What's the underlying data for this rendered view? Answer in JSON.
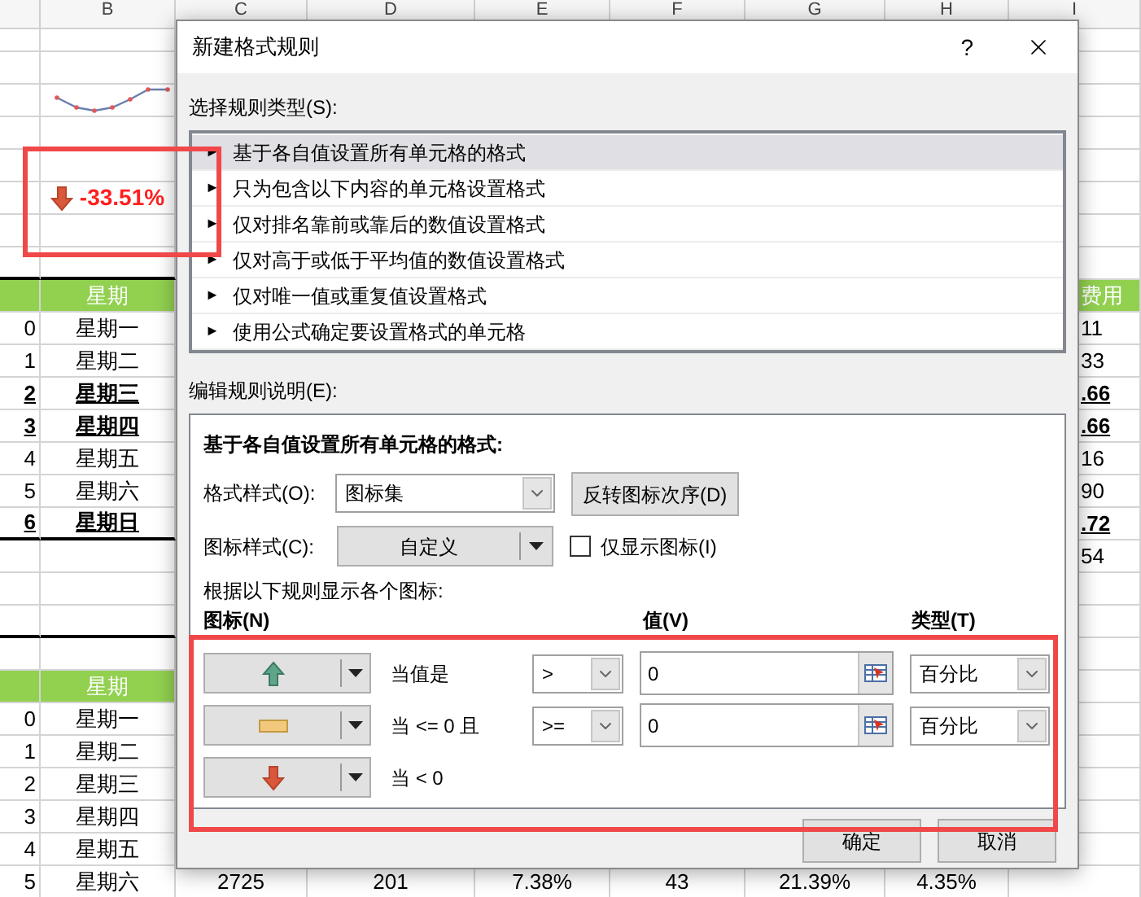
{
  "sheet": {
    "columns": [
      "B",
      "C",
      "D",
      "E",
      "F",
      "G",
      "H",
      "I"
    ],
    "rows": [
      {},
      {},
      {
        "b": {
          "kind": "sparkline"
        }
      },
      {},
      {},
      {
        "b": {
          "kind": "trend_down",
          "text": "-33.51%"
        }
      },
      {},
      {
        "border_below": true
      },
      {
        "a": {
          "kind": "header"
        },
        "b": {
          "kind": "header",
          "text": "星期"
        },
        "i": {
          "kind": "header",
          "text": "费用"
        }
      },
      {
        "a": {
          "text": "0"
        },
        "b": {
          "text": "星期一"
        },
        "i": {
          "text": "11"
        }
      },
      {
        "a": {
          "text": "1"
        },
        "b": {
          "text": "星期二"
        },
        "i": {
          "text": "33"
        }
      },
      {
        "a": {
          "text": "2",
          "emphasis": true
        },
        "b": {
          "text": "星期三",
          "emphasis": true
        },
        "i": {
          "text": ".66",
          "emphasis": true
        }
      },
      {
        "a": {
          "text": "3",
          "emphasis": true
        },
        "b": {
          "text": "星期四",
          "emphasis": true
        },
        "i": {
          "text": ".66",
          "emphasis": true
        }
      },
      {
        "a": {
          "text": "4"
        },
        "b": {
          "text": "星期五"
        },
        "i": {
          "text": "16"
        }
      },
      {
        "a": {
          "text": "5"
        },
        "b": {
          "text": "星期六"
        },
        "i": {
          "text": "90"
        }
      },
      {
        "a": {
          "text": "6",
          "emphasis": true
        },
        "b": {
          "text": "星期日",
          "emphasis": true
        },
        "i": {
          "text": ".72",
          "emphasis": true
        },
        "border_below": true
      },
      {
        "i": {
          "text": "54"
        }
      },
      {},
      {
        "border_below": true
      },
      {},
      {
        "a": {
          "kind": "header"
        },
        "b": {
          "kind": "header",
          "text": "星期"
        }
      },
      {
        "a": {
          "text": "0"
        },
        "b": {
          "text": "星期一"
        }
      },
      {
        "a": {
          "text": "1"
        },
        "b": {
          "text": "星期二"
        }
      },
      {
        "a": {
          "text": "2"
        },
        "b": {
          "text": "星期三"
        }
      },
      {
        "a": {
          "text": "3"
        },
        "b": {
          "text": "星期四"
        }
      },
      {
        "a": {
          "text": "4"
        },
        "b": {
          "text": "星期五"
        }
      },
      {
        "a": {
          "text": "5"
        },
        "b": {
          "text": "星期六"
        },
        "c": {
          "text": "2725"
        },
        "d": {
          "text": "201"
        },
        "e": {
          "text": "7.38%"
        },
        "f": {
          "text": "43"
        },
        "g": {
          "text": "21.39%"
        },
        "h": {
          "text": "4.35%"
        }
      }
    ]
  },
  "dialog": {
    "title": "新建格式规则",
    "help": "?",
    "rule_type_label": "选择规则类型(S):",
    "rule_types": [
      {
        "marker": "►",
        "label": "基于各自值设置所有单元格的格式",
        "selected": true
      },
      {
        "marker": "►",
        "label": "只为包含以下内容的单元格设置格式",
        "selected": false
      },
      {
        "marker": "►",
        "label": "仅对排名靠前或靠后的数值设置格式",
        "selected": false
      },
      {
        "marker": "►",
        "label": "仅对高于或低于平均值的数值设置格式",
        "selected": false
      },
      {
        "marker": "►",
        "label": "仅对唯一值或重复值设置格式",
        "selected": false
      },
      {
        "marker": "►",
        "label": "使用公式确定要设置格式的单元格",
        "selected": false
      }
    ],
    "edit_label": "编辑规则说明(E):",
    "description": {
      "heading": "基于各自值设置所有单元格的格式:",
      "format_style": {
        "label": "格式样式(O):",
        "value": "图标集"
      },
      "reverse_button": "反转图标次序(D)",
      "icon_style": {
        "label": "图标样式(C):",
        "value": "自定义"
      },
      "show_icon_only": {
        "label": "仅显示图标(I)",
        "checked": false
      },
      "rules_caption": "根据以下规则显示各个图标:",
      "column_headers": {
        "icon": "图标(N)",
        "value": "值(V)",
        "type": "类型(T)"
      },
      "icon_rules": [
        {
          "kind": "up",
          "condition": "当值是",
          "operator": ">",
          "value": "0",
          "type": "百分比"
        },
        {
          "kind": "flat",
          "condition": "当 <= 0 且",
          "operator": ">=",
          "value": "0",
          "type": "百分比"
        },
        {
          "kind": "down",
          "condition": "当 < 0"
        }
      ]
    },
    "buttons": [
      "确定",
      "取消"
    ]
  }
}
